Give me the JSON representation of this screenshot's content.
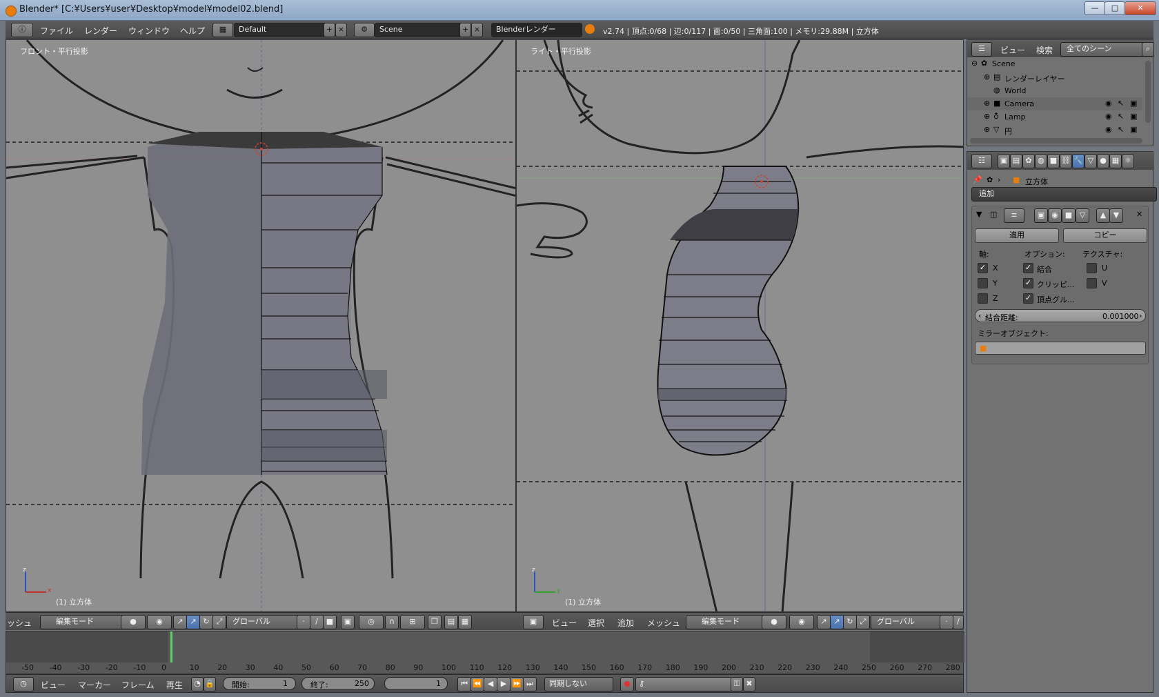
{
  "window": {
    "title": "Blender* [C:¥Users¥user¥Desktop¥model¥model02.blend]",
    "minimize": "—",
    "maximize": "□",
    "close": "✕"
  },
  "header": {
    "menus": [
      "ファイル",
      "レンダー",
      "ウィンドウ",
      "ヘルプ"
    ],
    "layout": "Default",
    "scene": "Scene",
    "engine": "Blenderレンダー",
    "stats": "v2.74 | 頂点:0/68 | 辺:0/117 | 面:0/50 | 三角面:100 | メモリ:29.88M | 立方体"
  },
  "viewport_left": {
    "label": "フロント・平行投影",
    "object": "(1) 立方体",
    "axis_x": "x",
    "axis_z": "z",
    "header": {
      "menu_partial": "ッシュ",
      "mode": "編集モード",
      "orientation": "グローバル"
    }
  },
  "viewport_right": {
    "label": "ライト・平行投影",
    "object": "(1) 立方体",
    "axis_y": "y",
    "axis_z": "z",
    "header": {
      "menus": [
        "ビュー",
        "選択",
        "追加",
        "メッシュ"
      ],
      "mode": "編集モード",
      "orientation": "グローバル"
    }
  },
  "outliner": {
    "view": "ビュー",
    "search": "検索",
    "scenes": "全てのシーン",
    "items": [
      {
        "label": "Scene"
      },
      {
        "label": "レンダーレイヤー"
      },
      {
        "label": "World"
      },
      {
        "label": "Camera"
      },
      {
        "label": "Lamp"
      },
      {
        "label": "円"
      }
    ]
  },
  "properties": {
    "object": "立方体",
    "add_modifier": "追加",
    "apply": "適用",
    "copy": "コピー",
    "axis_header": "軸:",
    "options_header": "オプション:",
    "texture_header": "テクスチャ:",
    "axis": [
      {
        "label": "X",
        "checked": true
      },
      {
        "label": "Y",
        "checked": false
      },
      {
        "label": "Z",
        "checked": false
      }
    ],
    "options": [
      {
        "label": "結合",
        "checked": true
      },
      {
        "label": "クリッピ...",
        "checked": true
      },
      {
        "label": "頂点グル...",
        "checked": true
      }
    ],
    "texture": [
      {
        "label": "U",
        "checked": false
      },
      {
        "label": "V",
        "checked": false
      }
    ],
    "merge_label": "結合距離:",
    "merge_value": "0.001000",
    "mirror_object_label": "ミラーオブジェクト:"
  },
  "timeline": {
    "ticks": [
      "-50",
      "-40",
      "-30",
      "-20",
      "-10",
      "0",
      "10",
      "20",
      "30",
      "40",
      "50",
      "60",
      "70",
      "80",
      "90",
      "100",
      "110",
      "120",
      "130",
      "140",
      "150",
      "160",
      "170",
      "180",
      "190",
      "200",
      "210",
      "220",
      "230",
      "240",
      "250",
      "260",
      "270",
      "280"
    ],
    "current_frame": 1,
    "menus": [
      "ビュー",
      "マーカー",
      "フレーム",
      "再生"
    ],
    "start_label": "開始:",
    "start": "1",
    "end_label": "終了:",
    "end": "250",
    "frame": "1",
    "sync": "同期しない"
  },
  "colors": {
    "accent": "#5680c2",
    "viewport_bg": "#8f8f8f",
    "header_bg": "#4e4e4e",
    "panel_bg": "#727272"
  }
}
